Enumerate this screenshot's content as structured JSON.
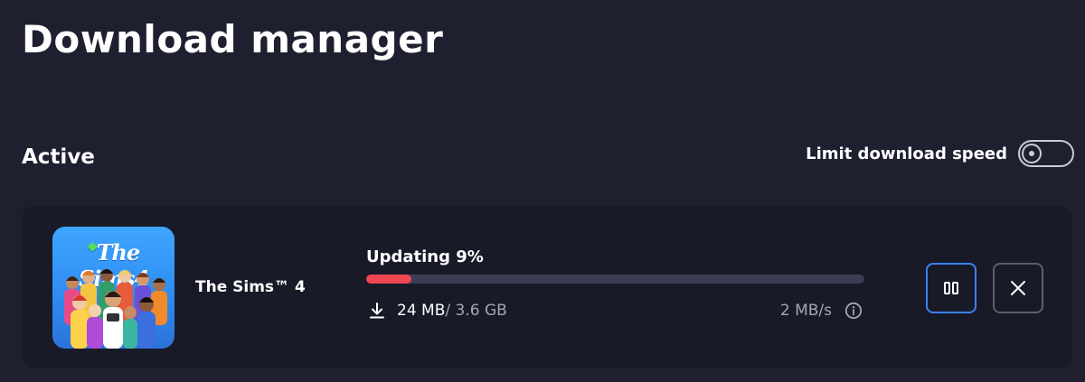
{
  "page": {
    "title": "Download manager"
  },
  "section": {
    "label": "Active"
  },
  "limit": {
    "label": "Limit download speed",
    "enabled": false
  },
  "download": {
    "game_name": "The Sims™ 4",
    "cover_logo": "The Sims4",
    "status": "Updating 9%",
    "progress_fraction": 0.09,
    "downloaded": "24 MB",
    "total": "/ 3.6 GB",
    "speed": "2 MB/s"
  },
  "icons": {
    "download": "download-arrow-icon",
    "info": "info-icon",
    "pause": "pause-icon",
    "cancel": "close-icon",
    "toggle": "toggle-switch"
  },
  "colors": {
    "background": "#1e2030",
    "card": "#181a28",
    "progress_fill": "#ef4652",
    "progress_track": "#3b3d52",
    "pause_border": "#3b82f6",
    "cancel_border": "#5b5e71"
  }
}
